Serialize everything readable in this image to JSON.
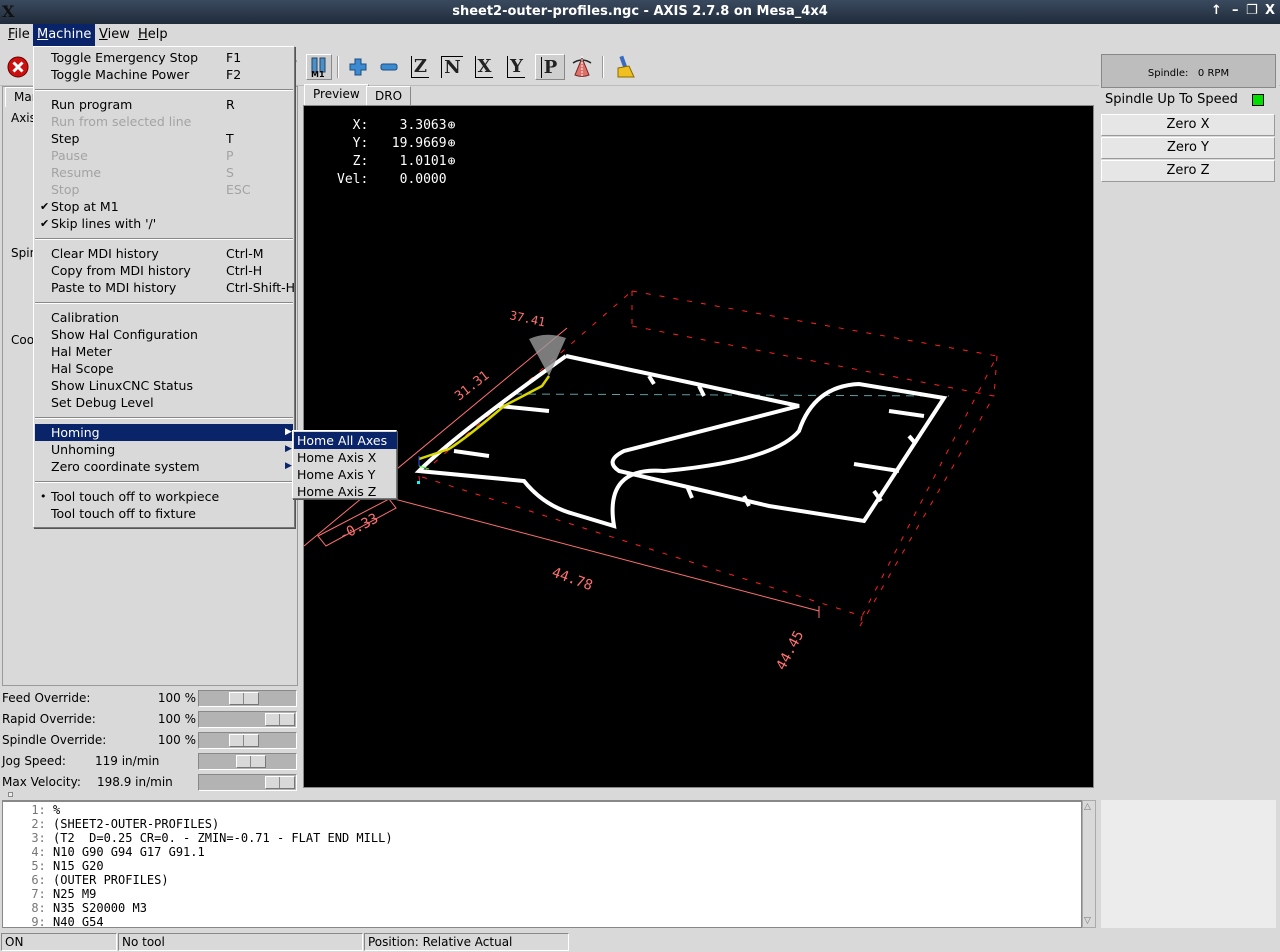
{
  "window": {
    "title": "sheet2-outer-profiles.ngc - AXIS 2.7.8 on Mesa_4x4",
    "logo": "X",
    "buttons": [
      "↑",
      "–",
      "❐",
      "X"
    ]
  },
  "menubar": {
    "items": [
      {
        "label": "File",
        "u": "F",
        "rest": "ile"
      },
      {
        "label": "Machine",
        "u": "M",
        "rest": "achine"
      },
      {
        "label": "View",
        "u": "V",
        "rest": "iew"
      },
      {
        "label": "Help",
        "u": "H",
        "rest": "elp"
      }
    ],
    "active": "Machine"
  },
  "toolbar": {
    "buttons": [
      {
        "name": "estop",
        "icon": "estop-icon"
      },
      {
        "name": "optional-stop",
        "icon": "m1-icon",
        "label": "M1"
      },
      {
        "name": "zoom-in",
        "icon": "plus-icon"
      },
      {
        "name": "zoom-out",
        "icon": "minus-icon"
      },
      {
        "name": "view-z",
        "icon": "view-z-icon",
        "label": "Z"
      },
      {
        "name": "view-z2",
        "icon": "view-z2-icon",
        "label": "N"
      },
      {
        "name": "view-x",
        "icon": "view-x-icon",
        "label": "X"
      },
      {
        "name": "view-y",
        "icon": "view-y-icon",
        "label": "Y"
      },
      {
        "name": "view-p",
        "icon": "view-p-icon",
        "label": "P"
      },
      {
        "name": "rotate",
        "icon": "cone-rotate-icon"
      },
      {
        "name": "clear-plot",
        "icon": "broom-icon"
      }
    ]
  },
  "machine_menu": {
    "items": [
      {
        "label": "Toggle Emergency Stop",
        "acc": "F1",
        "enabled": true
      },
      {
        "label": "Toggle Machine Power",
        "acc": "F2",
        "enabled": true
      },
      {
        "sep": true
      },
      {
        "label": "Run program",
        "acc": "R",
        "enabled": true
      },
      {
        "label": "Run from selected line",
        "acc": "",
        "enabled": false
      },
      {
        "label": "Step",
        "acc": "T",
        "enabled": true
      },
      {
        "label": "Pause",
        "acc": "P",
        "enabled": false
      },
      {
        "label": "Resume",
        "acc": "S",
        "enabled": false
      },
      {
        "label": "Stop",
        "acc": "ESC",
        "enabled": false
      },
      {
        "label": "Stop at M1",
        "acc": "",
        "enabled": true,
        "check": "✔"
      },
      {
        "label": "Skip lines with '/'",
        "acc": "",
        "enabled": true,
        "check": "✔"
      },
      {
        "sep": true
      },
      {
        "label": "Clear MDI history",
        "acc": "Ctrl-M",
        "enabled": true
      },
      {
        "label": "Copy from MDI history",
        "acc": "Ctrl-H",
        "enabled": true
      },
      {
        "label": "Paste to MDI history",
        "acc": "Ctrl-Shift-H",
        "enabled": true
      },
      {
        "sep": true
      },
      {
        "label": "Calibration",
        "acc": "",
        "enabled": true
      },
      {
        "label": "Show Hal Configuration",
        "acc": "",
        "enabled": true
      },
      {
        "label": "Hal Meter",
        "acc": "",
        "enabled": true
      },
      {
        "label": "Hal Scope",
        "acc": "",
        "enabled": true
      },
      {
        "label": "Show LinuxCNC Status",
        "acc": "",
        "enabled": true
      },
      {
        "label": "Set Debug Level",
        "acc": "",
        "enabled": true
      },
      {
        "sep": true
      },
      {
        "label": "Homing",
        "acc": "",
        "enabled": true,
        "submenu": true,
        "highlighted": true
      },
      {
        "label": "Unhoming",
        "acc": "",
        "enabled": true,
        "submenu": true
      },
      {
        "label": "Zero coordinate system",
        "acc": "",
        "enabled": true,
        "submenu": true
      },
      {
        "sep": true
      },
      {
        "label": "Tool touch off to workpiece",
        "acc": "",
        "enabled": true,
        "check": "•"
      },
      {
        "label": "Tool touch off to fixture",
        "acc": "",
        "enabled": true
      }
    ]
  },
  "homing_submenu": {
    "items": [
      {
        "label": "Home All Axes",
        "highlighted": true
      },
      {
        "label": "Home Axis X"
      },
      {
        "label": "Home Axis Y"
      },
      {
        "label": "Home Axis Z"
      }
    ]
  },
  "left_panel": {
    "tab_label": "Man",
    "labels": [
      {
        "text": "Axis"
      },
      {
        "text": "Spin"
      },
      {
        "text": "Cool"
      }
    ]
  },
  "overrides": [
    {
      "label": "Feed Override:",
      "value": "100 %",
      "fraction": 0.45
    },
    {
      "label": "Rapid Override:",
      "value": "100 %",
      "fraction": 1.0
    },
    {
      "label": "Spindle Override:",
      "value": "100 %",
      "fraction": 0.45
    },
    {
      "label": "Jog Speed:",
      "value": "119 in/min",
      "fraction": 0.55
    },
    {
      "label": "Max Velocity:",
      "value": "198.9 in/min",
      "fraction": 1.0
    }
  ],
  "preview": {
    "tabs": [
      "Preview",
      "DRO"
    ],
    "active_tab": "Preview",
    "dro": [
      {
        "axis": "X:",
        "value": "3.3063",
        "homed": true
      },
      {
        "axis": "Y:",
        "value": "19.9669",
        "homed": true
      },
      {
        "axis": "Z:",
        "value": "1.0101",
        "homed": true
      },
      {
        "axis": "Vel:",
        "value": "0.0000",
        "homed": false
      }
    ],
    "dimensions": {
      "top": "37.41",
      "left": "31.31",
      "z": "-0.33",
      "bottom": "44.78",
      "right": "44.45"
    },
    "colors": {
      "background": "#000000",
      "toolpath": "#ffffff",
      "extents": "#ff6f6f",
      "limits": "#ff2020",
      "live_plot": "#d8d800",
      "rapid": "#5f9ea0"
    }
  },
  "right_panel": {
    "spindle_label": "Spindle:",
    "spindle_value": "0 RPM",
    "up_to_speed_label": "Spindle Up To Speed",
    "up_to_speed_color": "#00e000",
    "buttons": [
      "Zero X",
      "Zero Y",
      "Zero Z"
    ]
  },
  "gcode": {
    "lines": [
      {
        "n": "1:",
        "text": "%"
      },
      {
        "n": "2:",
        "text": "(SHEET2-OUTER-PROFILES)"
      },
      {
        "n": "3:",
        "text": "(T2  D=0.25 CR=0. - ZMIN=-0.71 - FLAT END MILL)"
      },
      {
        "n": "4:",
        "text": "N10 G90 G94 G17 G91.1"
      },
      {
        "n": "5:",
        "text": "N15 G20"
      },
      {
        "n": "6:",
        "text": "(OUTER PROFILES)"
      },
      {
        "n": "7:",
        "text": "N25 M9"
      },
      {
        "n": "8:",
        "text": "N35 S20000 M3"
      },
      {
        "n": "9:",
        "text": "N40 G54"
      }
    ]
  },
  "statusbar": {
    "state": "ON",
    "tool": "No tool",
    "position": "Position: Relative Actual"
  }
}
